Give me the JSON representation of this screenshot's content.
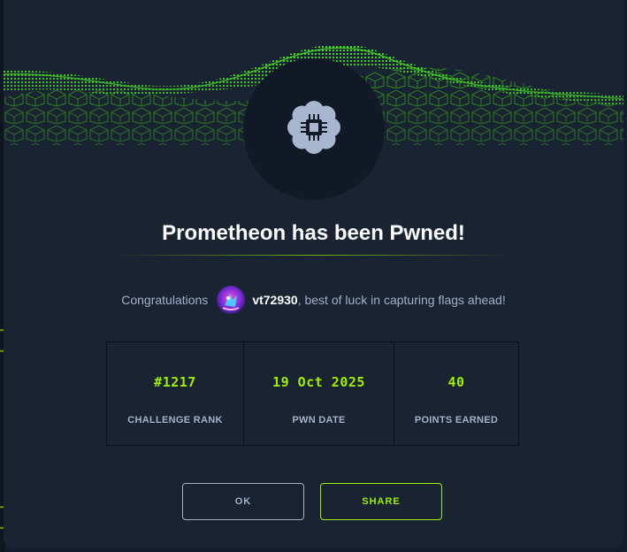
{
  "modal": {
    "title": "Prometheon has been Pwned!",
    "congrats": {
      "prefix": "Congratulations",
      "username": "vt72930",
      "suffix": ", best of luck in capturing flags ahead!"
    },
    "stats": [
      {
        "value": "#1217",
        "label": "CHALLENGE RANK"
      },
      {
        "value": "19 Oct 2025",
        "label": "PWN DATE"
      },
      {
        "value": "40",
        "label": "POINTS EARNED"
      }
    ],
    "buttons": {
      "ok": "OK",
      "share": "SHARE"
    }
  },
  "icons": {
    "challenge": "chip-flower-icon",
    "user_avatar": "user-avatar"
  },
  "colors": {
    "accent": "#9fef00",
    "background": "#1a2332",
    "text_muted": "#a4b1cd"
  }
}
